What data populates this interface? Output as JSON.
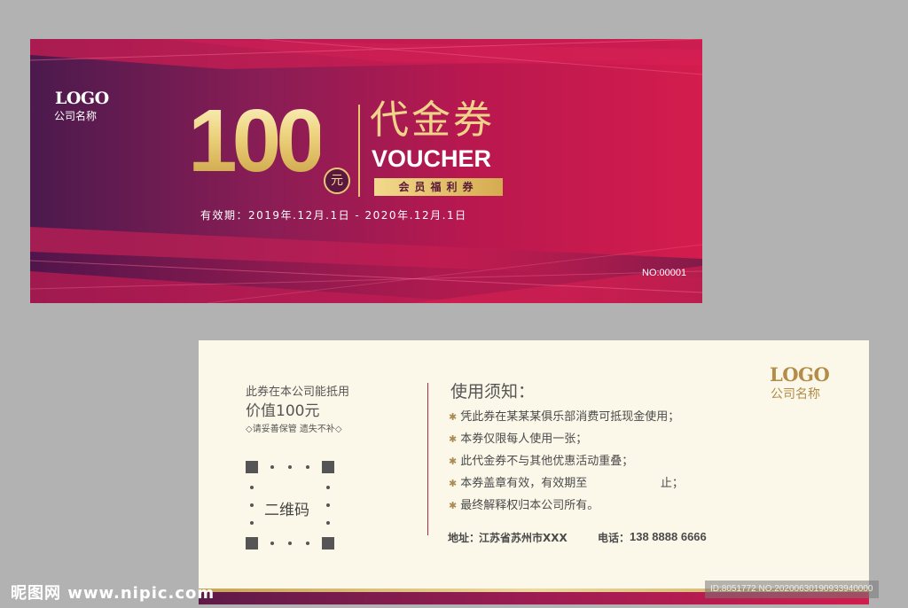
{
  "front": {
    "logo": "LOGO",
    "company": "公司名称",
    "amount": "100",
    "currency": "元",
    "title_cn": "代金券",
    "title_en": "VOUCHER",
    "member_badge": "会员福利券",
    "validity": "有效期：2019年.12月.1日 - 2020年.12月.1日",
    "number": "NO:00001",
    "colors": {
      "gradient_start": "#4b1a4d",
      "gradient_end": "#d41c4e",
      "gold": "#e6c36f"
    }
  },
  "back": {
    "logo": "LOGO",
    "company": "公司名称",
    "usage_line1": "此券在本公司能抵用",
    "usage_line2": "价值100元",
    "usage_line3": "◇请妥善保管 遗失不补◇",
    "qr_label": "二维码",
    "notice_title": "使用须知：",
    "notice_items": [
      "凭此券在某某某俱乐部消费可抵现金使用；",
      "本券仅限每人使用一张；",
      "此代金券不与其他优惠活动重叠；",
      "本券盖章有效，有效期至                    止；",
      "最终解释权归本公司所有。"
    ],
    "address_label": "地址：",
    "address_value": "江苏省苏州市XXX",
    "phone_label": "电话：",
    "phone_value": "138 8888 6666",
    "bullet_icon": "asterisk-icon",
    "colors": {
      "bg": "#fcf8e9",
      "gold": "#b28c48",
      "accent": "#b3283f"
    }
  },
  "watermark": {
    "site": "昵图网 www.nipic.com",
    "id": "ID:8051772 NO:20200630190933940000"
  }
}
